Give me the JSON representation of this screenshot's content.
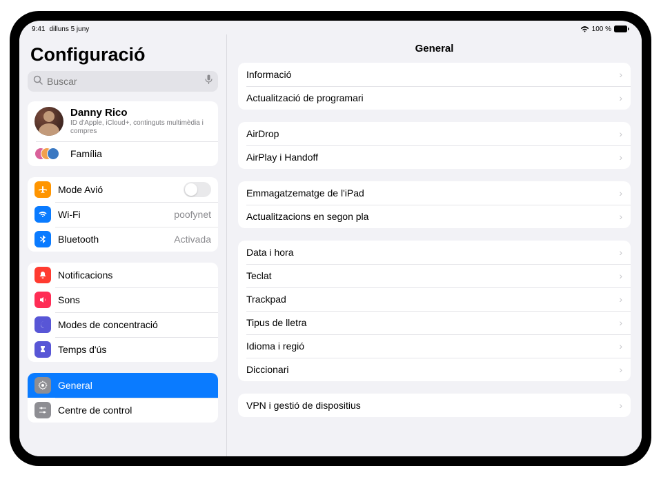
{
  "statusbar": {
    "time": "9:41",
    "date": "dilluns 5 juny",
    "battery": "100 %"
  },
  "sidebar": {
    "title": "Configuració",
    "search_placeholder": "Buscar",
    "profile": {
      "name": "Danny Rico",
      "subtitle": "ID d'Apple, iCloud+, continguts multimèdia i compres"
    },
    "family_label": "Família",
    "connectivity": {
      "airplane": "Mode Avió",
      "wifi": "Wi-Fi",
      "wifi_value": "poofynet",
      "bluetooth": "Bluetooth",
      "bluetooth_value": "Activada"
    },
    "group2": {
      "notifications": "Notificacions",
      "sounds": "Sons",
      "focus": "Modes de concentració",
      "screentime": "Temps d'ús"
    },
    "group3": {
      "general": "General",
      "control_center": "Centre de control"
    }
  },
  "detail": {
    "title": "General",
    "g1": {
      "info": "Informació",
      "software_update": "Actualització de programari"
    },
    "g2": {
      "airdrop": "AirDrop",
      "airplay": "AirPlay i Handoff"
    },
    "g3": {
      "storage": "Emmagatzematge de l'iPad",
      "bg_refresh": "Actualitzacions en segon pla"
    },
    "g4": {
      "date_time": "Data i hora",
      "keyboard": "Teclat",
      "trackpad": "Trackpad",
      "fonts": "Tipus de lletra",
      "language": "Idioma i regió",
      "dictionary": "Diccionari"
    },
    "g5": {
      "vpn": "VPN i gestió de dispositius"
    }
  },
  "colors": {
    "orange": "#ff9500",
    "blue": "#0a7bff",
    "red": "#ff3b30",
    "pink": "#ff2d55",
    "indigo": "#5856d6",
    "gray": "#8e8e93"
  }
}
